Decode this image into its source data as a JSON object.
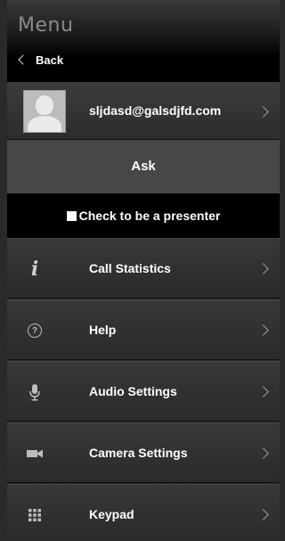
{
  "header": {
    "title": "Menu",
    "back_label": "Back"
  },
  "user": {
    "email": "sljdasd@galsdjfd.com"
  },
  "ask": {
    "label": "Ask"
  },
  "presenter": {
    "label": "Check to be a presenter",
    "checked": false
  },
  "menu_items": [
    {
      "label": "Call Statistics",
      "icon": "info-icon"
    },
    {
      "label": "Help",
      "icon": "help-icon"
    },
    {
      "label": "Audio Settings",
      "icon": "microphone-icon"
    },
    {
      "label": "Camera Settings",
      "icon": "camera-icon"
    },
    {
      "label": "Keypad",
      "icon": "keypad-icon"
    }
  ]
}
